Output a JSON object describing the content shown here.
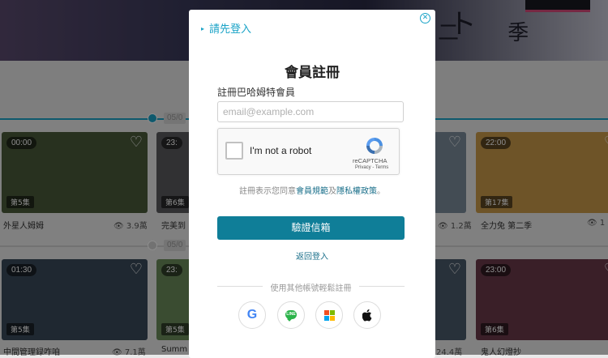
{
  "background": {
    "banner": {
      "kana": "ノ ー ト",
      "season": "二 季"
    },
    "timeline_tabs": [
      "05/0",
      "05/0"
    ],
    "row1": [
      {
        "time": "00:00",
        "episode": "第5集",
        "title": "外星人姆姆",
        "views": "3.9萬",
        "tint": "#4a5a3a"
      },
      {
        "time": "23:",
        "episode": "第6集",
        "title": "完美到",
        "views": "",
        "tint": "#5a5a5e"
      },
      {
        "time": "",
        "episode": "",
        "title": "",
        "views": "1.2萬",
        "tint": "#7a8a9a"
      },
      {
        "time": "22:00",
        "episode": "第17集",
        "title": "全力兔 第二季",
        "views": "1",
        "tint": "#c99a4a"
      }
    ],
    "row2": [
      {
        "time": "01:30",
        "episode": "第5集",
        "title": "中間管理録咋咱",
        "views": "7.1萬",
        "tint": "#3a4a5a"
      },
      {
        "time": "23:",
        "episode": "第5集",
        "title": "Summ",
        "views": "",
        "tint": "#6a8a5a"
      },
      {
        "time": "",
        "episode": "",
        "title": "",
        "views": "24.4萬",
        "tint": "#4a5a6a"
      },
      {
        "time": "23:00",
        "episode": "第6集",
        "title": "鬼人幻燈抄",
        "views": "",
        "tint": "#6a3a4a"
      }
    ]
  },
  "modal": {
    "back_login": "請先登入",
    "close_icon": "close-icon",
    "title": "會員註冊",
    "subtitle": "註冊巴哈姆特會員",
    "email_placeholder": "email@example.com",
    "recaptcha": {
      "label": "I'm not a robot",
      "brand": "reCAPTCHA",
      "links": "Privacy - Terms"
    },
    "terms_prefix": "註冊表示您同意",
    "terms_link1": "會員規範",
    "terms_and": "及",
    "terms_link2": "隱私權政策",
    "terms_suffix": "。",
    "verify_button": "驗證信箱",
    "return_login": "返回登入",
    "social_divider": "使用其他帳號輕鬆註冊",
    "social": [
      {
        "name": "google",
        "glyph": "G"
      },
      {
        "name": "line",
        "glyph": "LINE"
      },
      {
        "name": "microsoft",
        "glyph": ""
      },
      {
        "name": "apple",
        "glyph": ""
      }
    ],
    "colors": {
      "accent": "#1aa3c7",
      "button": "#0f7e98",
      "link": "#1a6f8a"
    }
  }
}
